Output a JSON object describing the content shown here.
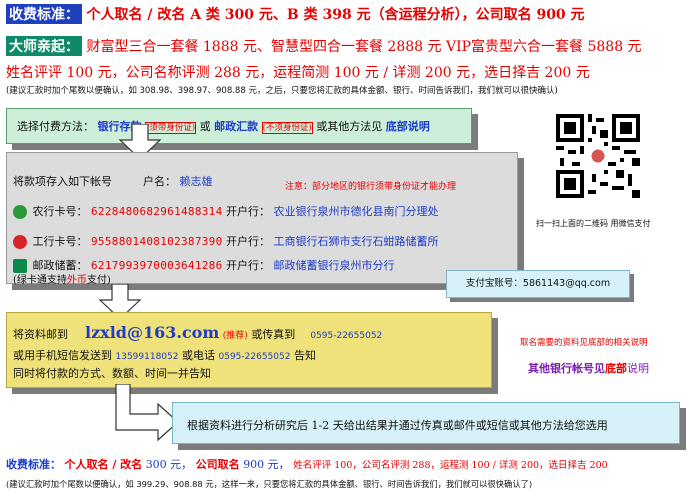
{
  "top": {
    "std_tag": "收费标准：",
    "std_text": "个人取名 / 改名 A 类 300 元、B 类 398 元（含运程分析），公司取名 900 元",
    "master_tag": "大师亲起：",
    "master_text": "财富型三合一套餐 1888 元、智慧型四合一套餐 2888 元 VIP富贵型六合一套餐 5888 元",
    "line3": "姓名评评 100 元，公司名称评测 288 元，运程简测 100 元 / 详测 200 元，选日择吉 200 元",
    "line4": "(建议汇款时加个尾数以便确认，如 308.98、398.97、908.88 元，之后，只要您将汇款的具体金额、银行、时间告诉我们，我们就可以很快确认)"
  },
  "box1": {
    "prefix": "选择付费方法：",
    "bank": "银行存款",
    "bank_note": "(须带身份证)",
    "or1": "或",
    "post": "邮政汇款",
    "post_note": "(不须身份证)",
    "suffix": "或其他方法见",
    "bottom": "底部说明"
  },
  "box2": {
    "title": "将款项存入如下帐号",
    "holder_label": "户名：",
    "holder": "赖志雄",
    "notice": "注意：部分地区的银行须带身份证才能办理",
    "accounts": [
      {
        "label": "农行卡号：",
        "number": "6228480682961488314",
        "branch_label": "开户行：",
        "branch": "农业银行泉州市德化县南门分理处",
        "color": "#2a9a3a"
      },
      {
        "label": "工行卡号：",
        "number": "9558801408102387390",
        "branch_label": "开户行：",
        "branch": "工商银行石狮市支行石蚶路储蓄所",
        "color": "#d8232a"
      },
      {
        "label": "邮政储蓄：",
        "number": "6217993970003641286",
        "branch_label": "开户行：",
        "branch": "邮政储蓄银行泉州市分行",
        "color": "#0a8a4a"
      }
    ],
    "green_card_prefix": "(绿卡通支持",
    "green_card_highlight": "外币",
    "green_card_suffix": "支付)"
  },
  "alipay": {
    "text": "支付宝账号：5861143@qq.com"
  },
  "qr": {
    "caption": "扫一扫上面的二维码 用微信支付"
  },
  "box3": {
    "send_prefix": "将资料邮到",
    "email": "lzxld@163.com",
    "recommend": "(推荐)",
    "fax_prefix": "或传真到",
    "fax": "0595-22655052",
    "sms_prefix": "或用手机短信发送到",
    "mobile": "13599118052",
    "phone_prefix": "或电话",
    "phone": "0595-22655052",
    "phone_suffix": "告知",
    "line3": "同时将付款的方式、数额、时间一并告知"
  },
  "right_note": {
    "line1": "取名需要的资料见底部的相关说明",
    "other_prefix": "其他银行帐号见",
    "other_highlight": "底部",
    "other_suffix": "说明"
  },
  "box4": {
    "text": "根据资料进行分析研究后 1-2 天给出结果并通过传真或邮件或短信或其他方法给您选用"
  },
  "bottom": {
    "tag": "收费标准：",
    "a1": "个人取名 / 改名",
    "v1": "300 元，",
    "a2": "公司取名",
    "v2": "900 元，",
    "rest": "姓名评评 100，公司名评测 288，运程测 100 / 详测 200，选日择吉 200",
    "note": "(建议汇款时加个尾数以便确认，如 399.29、908.88 元，这样一来，只要您将汇款的具体金额、银行、时间告诉我们，我们就可以很快确认了)"
  }
}
